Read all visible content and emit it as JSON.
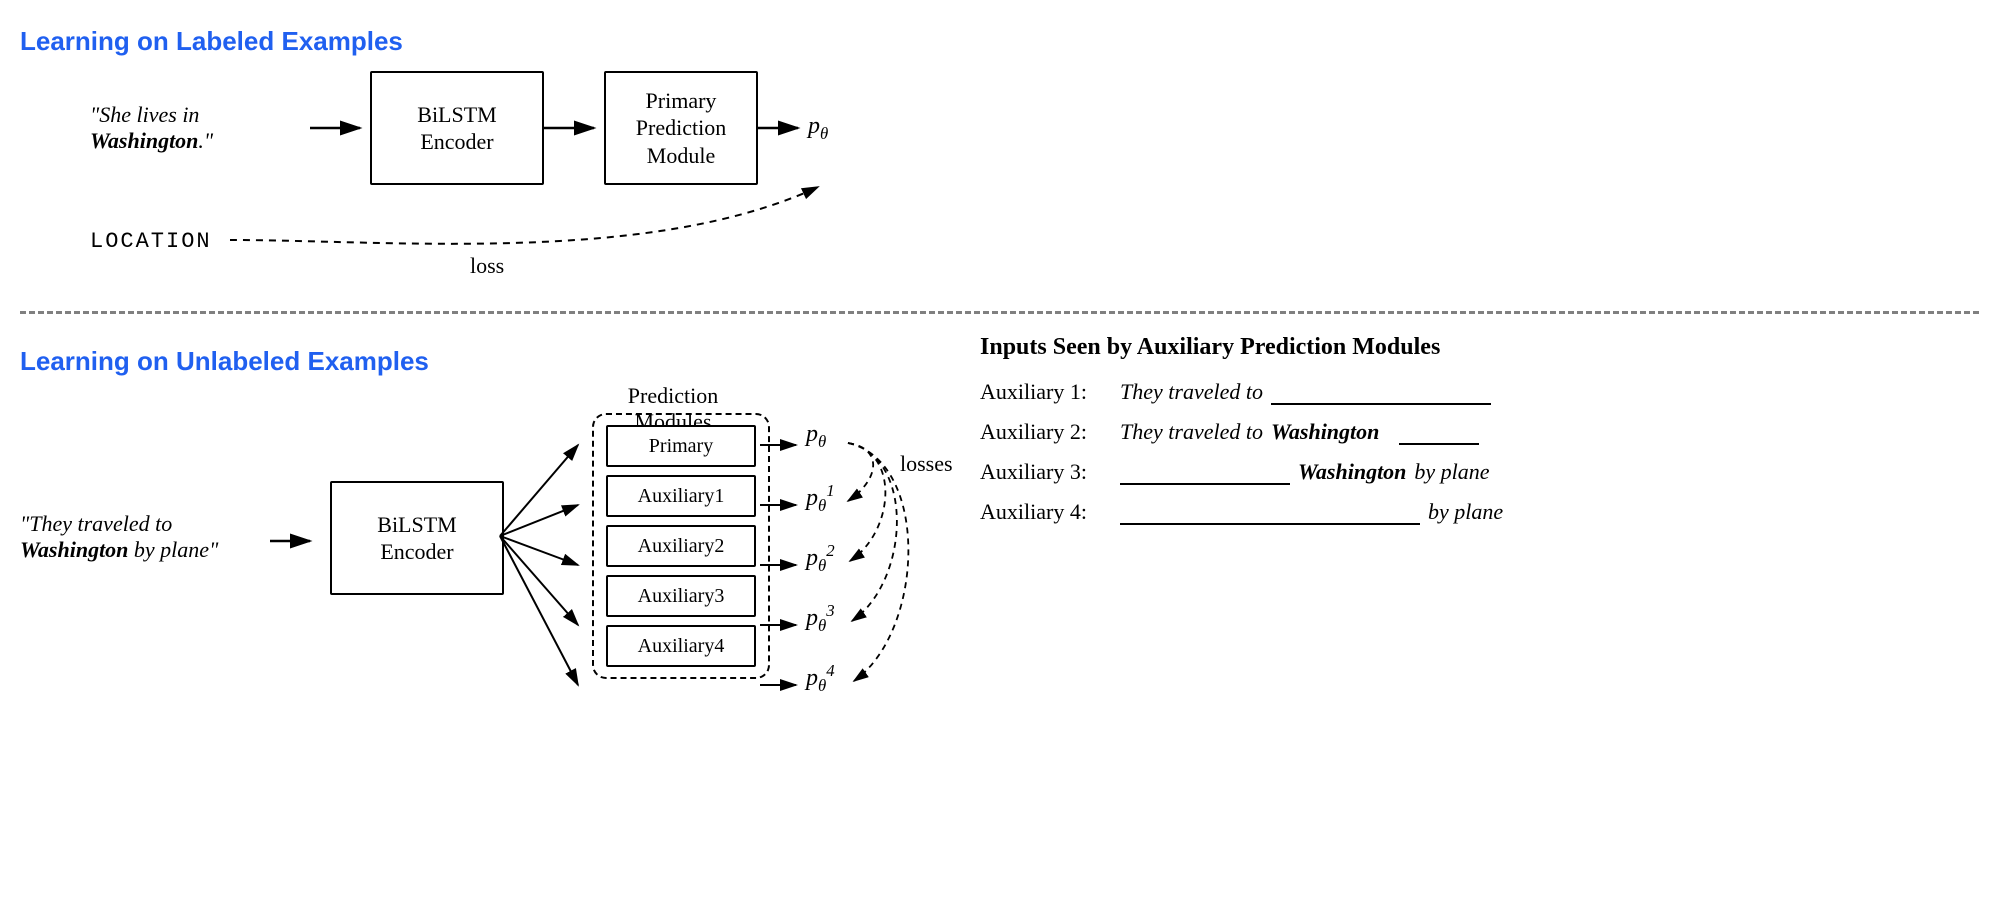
{
  "top": {
    "heading": "Learning on Labeled Examples",
    "input_prefix": "\"She lives in ",
    "input_bold": "Washington",
    "input_suffix": ".\"",
    "encoder": "BiLSTM\nEncoder",
    "module": "Primary\nPrediction\nModule",
    "output": "p",
    "output_sub": "θ",
    "gold_label": "LOCATION",
    "loss_label": "loss"
  },
  "bottom": {
    "heading": "Learning on Unlabeled Examples",
    "modules_title": "Prediction Modules",
    "input_prefix": "\"They traveled to ",
    "input_bold": "Washington",
    "input_suffix": " by plane\"",
    "encoder": "BiLSTM\nEncoder",
    "primary_label": "Primary",
    "aux_prefix": "Auxiliary ",
    "aux": [
      "1",
      "2",
      "3",
      "4"
    ],
    "p": "p",
    "theta": "θ",
    "losses_label": "losses"
  },
  "right": {
    "title": "Inputs Seen by Auxiliary Prediction Modules",
    "rows": [
      {
        "label": "Auxiliary 1:",
        "pre": "They traveled to",
        "bold": "",
        "post": ""
      },
      {
        "label": "Auxiliary 2:",
        "pre": "They traveled to",
        "bold": "Washington",
        "post": ""
      },
      {
        "label": "Auxiliary 3:",
        "pre": "",
        "bold": "Washington",
        "post": "by plane"
      },
      {
        "label": "Auxiliary 4:",
        "pre": "",
        "bold": "",
        "post": "by plane"
      }
    ]
  }
}
